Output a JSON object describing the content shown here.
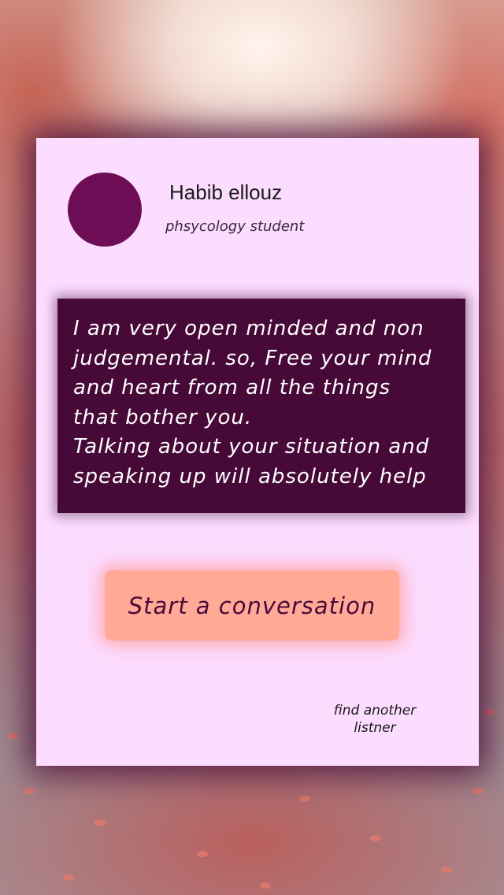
{
  "profile": {
    "name": "Habib ellouz",
    "role": "phsycology student",
    "avatar_color": "#6d0d55"
  },
  "bio": {
    "text": "I am very open minded and non\njudgemental. so, Free your mind\nand heart from all the things\nthat bother you.\nTalking about your situation and\nspeaking up will absolutely help"
  },
  "actions": {
    "start_label": "Start a conversation",
    "find_label": "find another\nlistner"
  },
  "colors": {
    "card_bg": "#fcdcff",
    "bio_bg": "#470a38",
    "button_bg": "#ffa996",
    "button_text": "#4a0a3a"
  }
}
